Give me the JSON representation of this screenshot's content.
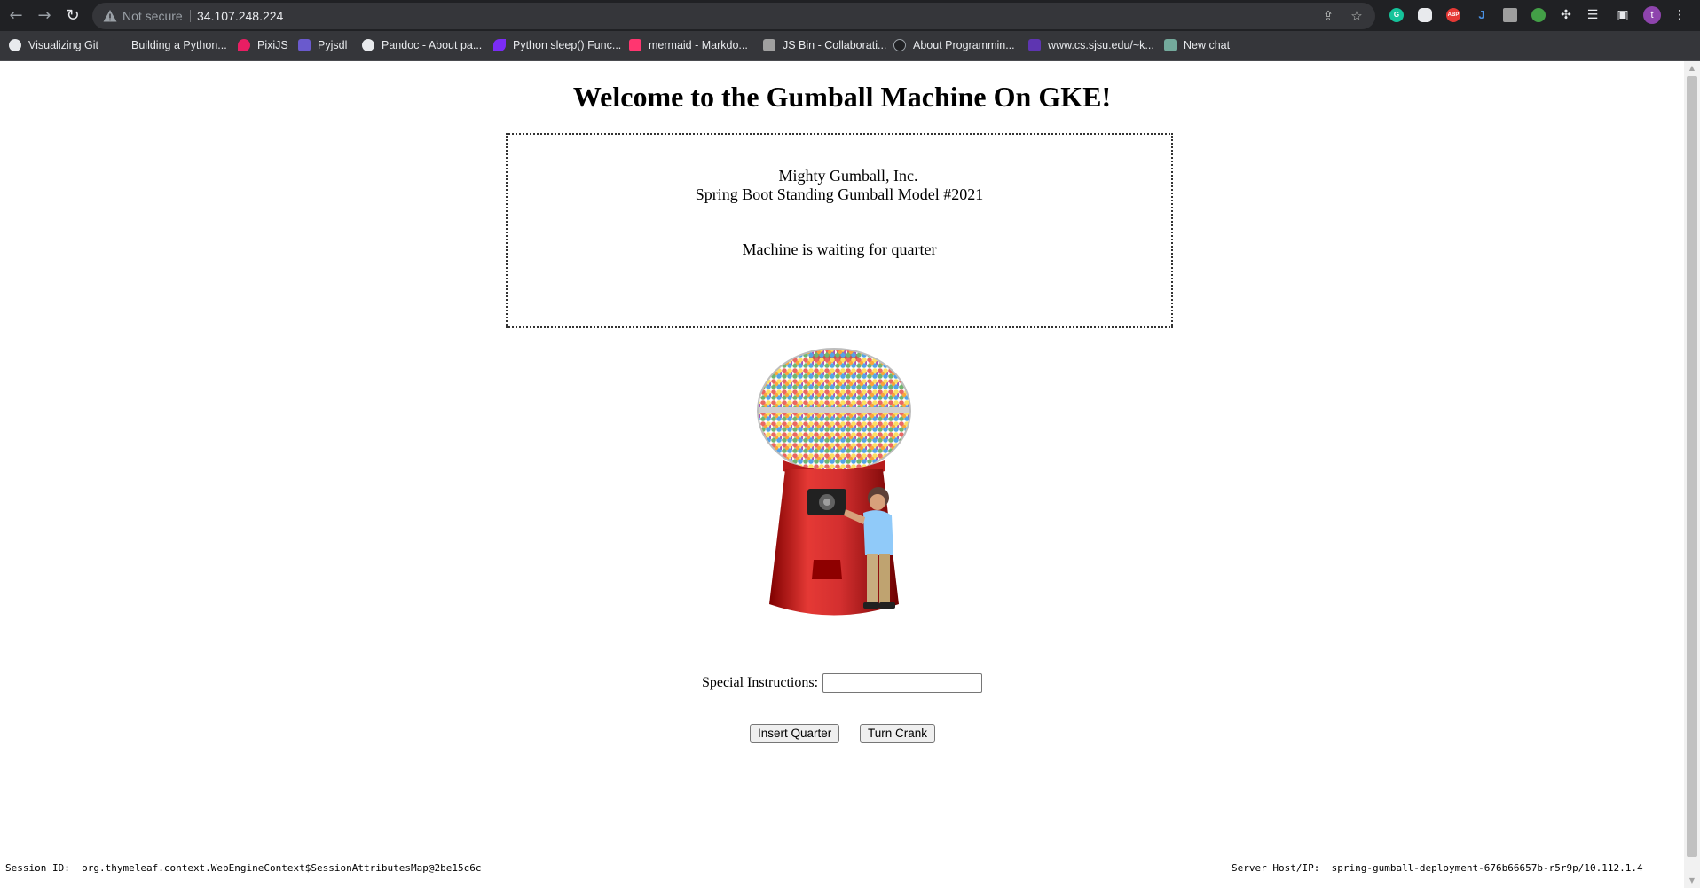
{
  "browser": {
    "security_label": "Not secure",
    "url": "34.107.248.224",
    "bookmarks": [
      {
        "label": "Visualizing Git",
        "icon": "github-icon",
        "color": "#e8eaed"
      },
      {
        "label": "Building a Python...",
        "icon": "page-icon",
        "color": "#35363a"
      },
      {
        "label": "PixiJS",
        "icon": "pixijs-icon",
        "color": "#e91e63"
      },
      {
        "label": "Pyjsdl",
        "icon": "pyjsdl-icon",
        "color": "#6a5acd"
      },
      {
        "label": "Pandoc - About pa...",
        "icon": "github-icon",
        "color": "#e8eaed"
      },
      {
        "label": "Python sleep() Func...",
        "icon": "python-icon",
        "color": "#7b2cf5"
      },
      {
        "label": "mermaid - Markdo...",
        "icon": "mermaid-icon",
        "color": "#ff3670"
      },
      {
        "label": "JS Bin - Collaborati...",
        "icon": "jsbin-icon",
        "color": "#a0a0a0"
      },
      {
        "label": "About Programmin...",
        "icon": "gear-icon",
        "color": "#202124"
      },
      {
        "label": "www.cs.sjsu.edu/~k...",
        "icon": "globe-icon",
        "color": "#5e35b1"
      },
      {
        "label": "New chat",
        "icon": "chat-icon",
        "color": "#74aa9c"
      }
    ],
    "extensions": [
      {
        "name": "grammarly-icon",
        "glyph": "G",
        "color": "#15c39a"
      },
      {
        "name": "ghost-icon",
        "glyph": "",
        "color": "#e8eaed"
      },
      {
        "name": "adblock-icon",
        "glyph": "ABP",
        "color": "#e53935"
      },
      {
        "name": "j-extension-icon",
        "glyph": "J",
        "color": "#1565c0"
      },
      {
        "name": "gray-extension-icon",
        "glyph": "",
        "color": "#9e9e9e"
      },
      {
        "name": "android-extension-icon",
        "glyph": "",
        "color": "#43a047"
      }
    ],
    "profile_initial": "t"
  },
  "page": {
    "title": "Welcome to the Gumball Machine On GKE!",
    "company": "Mighty Gumball, Inc.",
    "model": "Spring Boot Standing Gumball Model #2021",
    "status": "Machine is waiting for quarter",
    "instructions_label": "Special Instructions:",
    "instructions_value": "",
    "insert_quarter_label": "Insert Quarter",
    "turn_crank_label": "Turn Crank",
    "session_label": "Session ID:",
    "session_value": "org.thymeleaf.context.WebEngineContext$SessionAttributesMap@2be15c6c",
    "server_label": "Server Host/IP:",
    "server_value": "spring-gumball-deployment-676b66657b-r5r9p/10.112.1.4"
  }
}
